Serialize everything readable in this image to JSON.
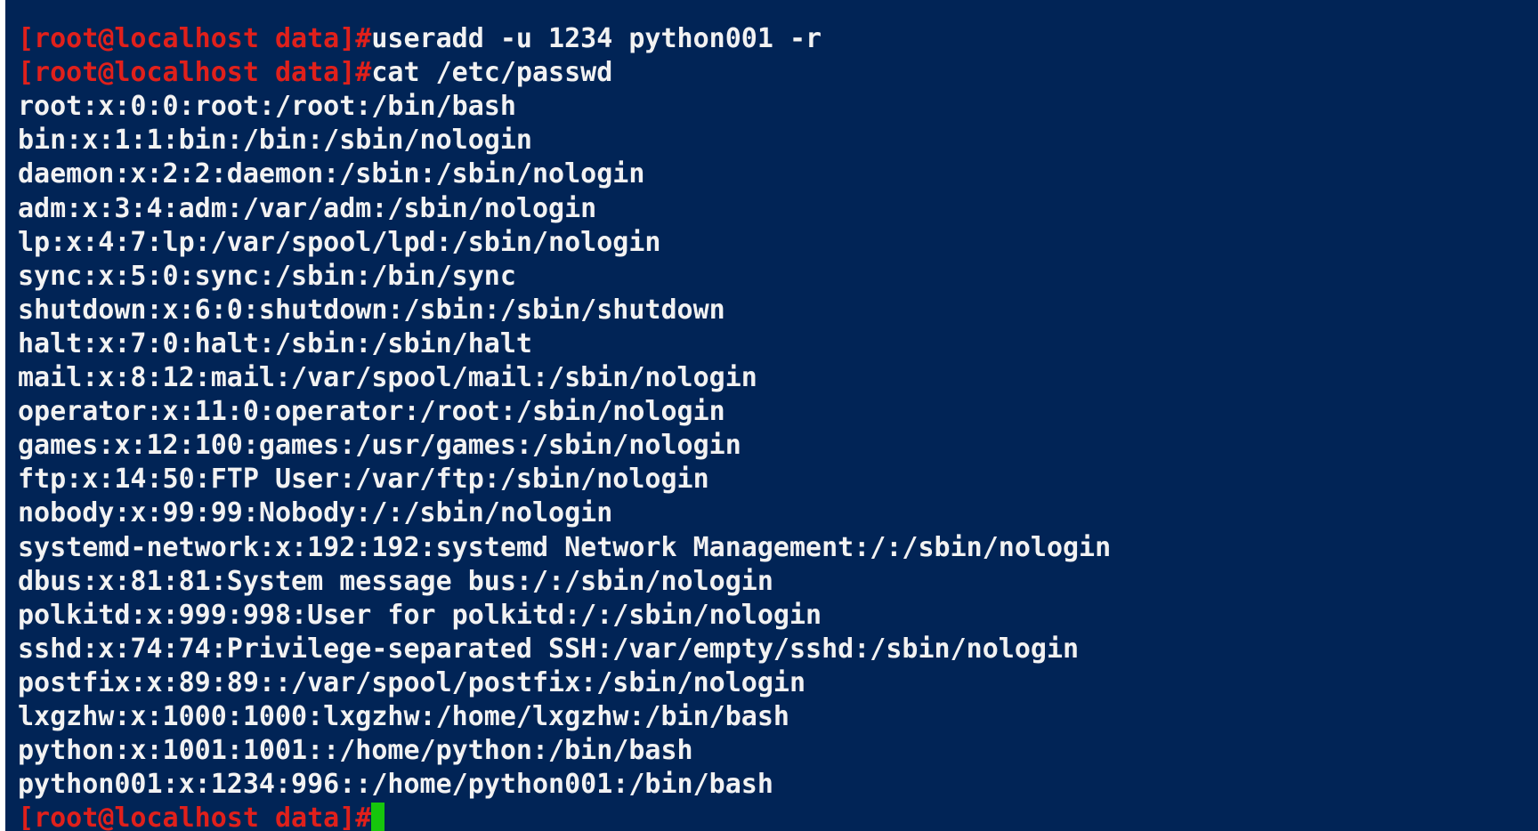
{
  "terminal": {
    "colors": {
      "background": "#012456",
      "foreground": "#f2f2f2",
      "prompt": "#e0201b",
      "cursor": "#16c60c"
    },
    "lines": [
      {
        "prompt": "",
        "text": "      ",
        "kind": "output"
      },
      {
        "prompt": "[root@localhost data]#",
        "text": "useradd -u 1234 python001 -r",
        "kind": "command"
      },
      {
        "prompt": "[root@localhost data]#",
        "text": "cat /etc/passwd",
        "kind": "command"
      },
      {
        "prompt": "",
        "text": "root:x:0:0:root:/root:/bin/bash",
        "kind": "output"
      },
      {
        "prompt": "",
        "text": "bin:x:1:1:bin:/bin:/sbin/nologin",
        "kind": "output"
      },
      {
        "prompt": "",
        "text": "daemon:x:2:2:daemon:/sbin:/sbin/nologin",
        "kind": "output"
      },
      {
        "prompt": "",
        "text": "adm:x:3:4:adm:/var/adm:/sbin/nologin",
        "kind": "output"
      },
      {
        "prompt": "",
        "text": "lp:x:4:7:lp:/var/spool/lpd:/sbin/nologin",
        "kind": "output"
      },
      {
        "prompt": "",
        "text": "sync:x:5:0:sync:/sbin:/bin/sync",
        "kind": "output"
      },
      {
        "prompt": "",
        "text": "shutdown:x:6:0:shutdown:/sbin:/sbin/shutdown",
        "kind": "output"
      },
      {
        "prompt": "",
        "text": "halt:x:7:0:halt:/sbin:/sbin/halt",
        "kind": "output"
      },
      {
        "prompt": "",
        "text": "mail:x:8:12:mail:/var/spool/mail:/sbin/nologin",
        "kind": "output"
      },
      {
        "prompt": "",
        "text": "operator:x:11:0:operator:/root:/sbin/nologin",
        "kind": "output"
      },
      {
        "prompt": "",
        "text": "games:x:12:100:games:/usr/games:/sbin/nologin",
        "kind": "output"
      },
      {
        "prompt": "",
        "text": "ftp:x:14:50:FTP User:/var/ftp:/sbin/nologin",
        "kind": "output"
      },
      {
        "prompt": "",
        "text": "nobody:x:99:99:Nobody:/:/sbin/nologin",
        "kind": "output"
      },
      {
        "prompt": "",
        "text": "systemd-network:x:192:192:systemd Network Management:/:/sbin/nologin",
        "kind": "output"
      },
      {
        "prompt": "",
        "text": "dbus:x:81:81:System message bus:/:/sbin/nologin",
        "kind": "output"
      },
      {
        "prompt": "",
        "text": "polkitd:x:999:998:User for polkitd:/:/sbin/nologin",
        "kind": "output"
      },
      {
        "prompt": "",
        "text": "sshd:x:74:74:Privilege-separated SSH:/var/empty/sshd:/sbin/nologin",
        "kind": "output"
      },
      {
        "prompt": "",
        "text": "postfix:x:89:89::/var/spool/postfix:/sbin/nologin",
        "kind": "output"
      },
      {
        "prompt": "",
        "text": "lxgzhw:x:1000:1000:lxgzhw:/home/lxgzhw:/bin/bash",
        "kind": "output"
      },
      {
        "prompt": "",
        "text": "python:x:1001:1001::/home/python:/bin/bash",
        "kind": "output"
      },
      {
        "prompt": "",
        "text": "python001:x:1234:996::/home/python001:/bin/bash",
        "kind": "output"
      },
      {
        "prompt": "[root@localhost data]#",
        "text": "",
        "kind": "active-prompt"
      }
    ]
  }
}
